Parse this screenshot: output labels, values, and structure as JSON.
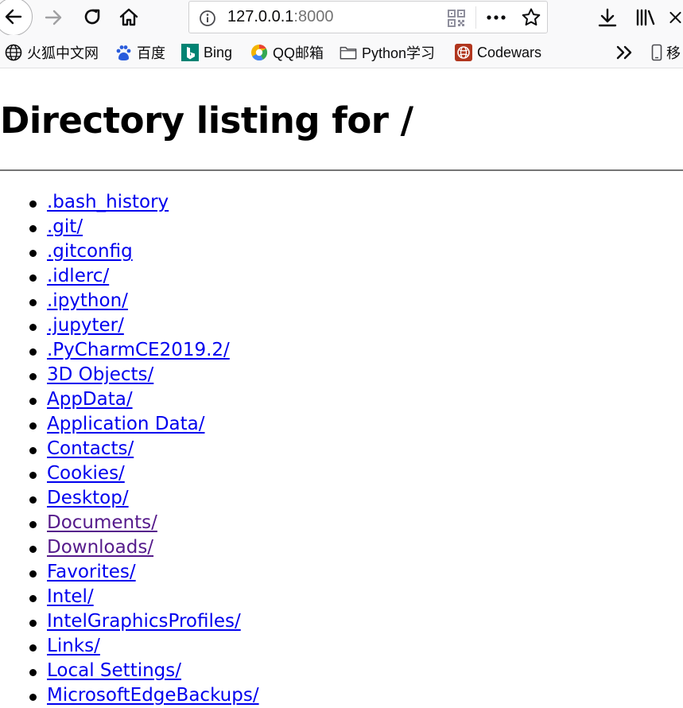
{
  "browser": {
    "url_host": "127.0.0.1",
    "url_port": ":8000",
    "icons": {
      "back": "back-arrow-icon",
      "forward": "forward-arrow-icon",
      "reload": "reload-icon",
      "home": "home-icon",
      "info": "info-icon",
      "qr": "qr-code-icon",
      "more": "more-dots-icon",
      "star": "bookmark-star-icon",
      "downloads": "download-icon",
      "library": "library-icon",
      "close": "close-icon"
    }
  },
  "bookmarks": [
    {
      "label": "火狐中文网",
      "icon": "globe-icon"
    },
    {
      "label": "百度",
      "icon": "baidu-paw-icon"
    },
    {
      "label": "Bing",
      "icon": "bing-icon"
    },
    {
      "label": "QQ邮箱",
      "icon": "qq-mail-icon"
    },
    {
      "label": "Python学习",
      "icon": "folder-icon"
    },
    {
      "label": "Codewars",
      "icon": "codewars-icon"
    }
  ],
  "bookmarks_overflow": "移",
  "page": {
    "title": "Directory listing for /",
    "entries": [
      {
        "name": ".bash_history",
        "visited": false
      },
      {
        "name": ".git/",
        "visited": false
      },
      {
        "name": ".gitconfig",
        "visited": false
      },
      {
        "name": ".idlerc/",
        "visited": false
      },
      {
        "name": ".ipython/",
        "visited": false
      },
      {
        "name": ".jupyter/",
        "visited": false
      },
      {
        "name": ".PyCharmCE2019.2/",
        "visited": false
      },
      {
        "name": "3D Objects/",
        "visited": false
      },
      {
        "name": "AppData/",
        "visited": false
      },
      {
        "name": "Application Data/",
        "visited": false
      },
      {
        "name": "Contacts/",
        "visited": false
      },
      {
        "name": "Cookies/",
        "visited": false
      },
      {
        "name": "Desktop/",
        "visited": false
      },
      {
        "name": "Documents/",
        "visited": true
      },
      {
        "name": "Downloads/",
        "visited": true
      },
      {
        "name": "Favorites/",
        "visited": false
      },
      {
        "name": "Intel/",
        "visited": false
      },
      {
        "name": "IntelGraphicsProfiles/",
        "visited": false
      },
      {
        "name": "Links/",
        "visited": false
      },
      {
        "name": "Local Settings/",
        "visited": false
      },
      {
        "name": "MicrosoftEdgeBackups/",
        "visited": false
      }
    ]
  },
  "colors": {
    "link": "#0000ee",
    "link_visited": "#551a8b",
    "toolbar_bg": "#f9f9fa"
  }
}
